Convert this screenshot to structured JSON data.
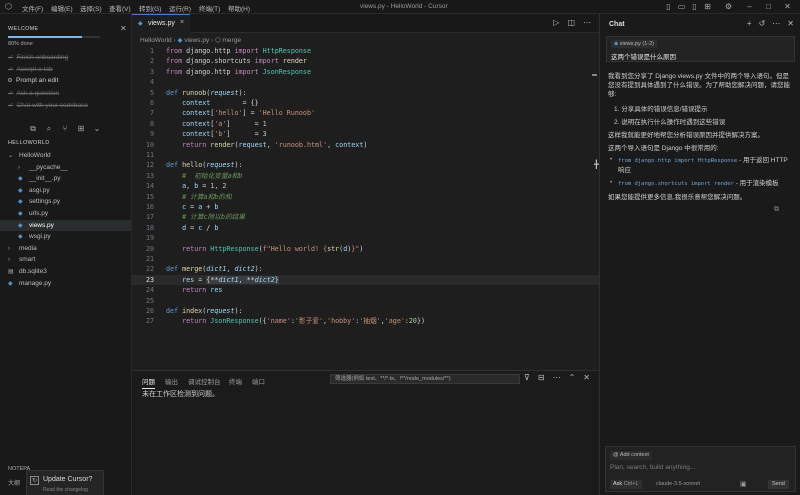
{
  "titlebar": {
    "menus": [
      "文件(F)",
      "编辑(E)",
      "选择(S)",
      "查看(V)",
      "转到(G)",
      "运行(R)",
      "终端(T)",
      "帮助(H)"
    ],
    "title": "views.py - HelloWorld - Cursor"
  },
  "sidebar": {
    "welcome": {
      "heading": "WELCOME",
      "progress_percent": 80,
      "progress_label": "80% done",
      "steps": [
        {
          "label": "Finish onboarding",
          "done": true
        },
        {
          "label": "Accept a tab",
          "done": true
        },
        {
          "label": "Prompt an edit",
          "done": false
        },
        {
          "label": "Ask a question",
          "done": true
        },
        {
          "label": "Chat with your codebase",
          "done": true
        }
      ]
    },
    "explorer": {
      "heading": "HELLOWORLD",
      "items": [
        {
          "label": "HelloWorld",
          "type": "folder-open",
          "depth": 0
        },
        {
          "label": "__pycache__",
          "type": "folder",
          "depth": 1
        },
        {
          "label": "__init__.py",
          "type": "py",
          "depth": 1
        },
        {
          "label": "asgi.py",
          "type": "py",
          "depth": 1
        },
        {
          "label": "settings.py",
          "type": "py",
          "depth": 1
        },
        {
          "label": "urls.py",
          "type": "py",
          "depth": 1
        },
        {
          "label": "views.py",
          "type": "py",
          "depth": 1,
          "selected": true
        },
        {
          "label": "wsgi.py",
          "type": "py",
          "depth": 1
        },
        {
          "label": "media",
          "type": "folder",
          "depth": 0
        },
        {
          "label": "smart",
          "type": "folder",
          "depth": 0
        },
        {
          "label": "db.sqlite3",
          "type": "db",
          "depth": 0
        },
        {
          "label": "manage.py",
          "type": "py",
          "depth": 0
        }
      ]
    },
    "notepad": "NOTEPA",
    "outline": "大纲",
    "update": {
      "title": "Update Cursor?",
      "subtitle": "Read the changelog"
    }
  },
  "editor": {
    "tab_label": "views.py",
    "breadcrumb": [
      "HelloWorld",
      "views.py",
      "merge"
    ],
    "current_line": 23,
    "lines": [
      {
        "n": 1,
        "tokens": [
          [
            "kw2",
            "from"
          ],
          [
            "t",
            " django.http "
          ],
          [
            "kw2",
            "import"
          ],
          [
            "cls",
            " HttpResponse"
          ]
        ]
      },
      {
        "n": 2,
        "tokens": [
          [
            "kw2",
            "from"
          ],
          [
            "t",
            " django.shortcuts "
          ],
          [
            "kw2",
            "import"
          ],
          [
            "fn",
            " render"
          ]
        ]
      },
      {
        "n": 3,
        "tokens": [
          [
            "kw2",
            "from"
          ],
          [
            "t",
            " django.http "
          ],
          [
            "kw2",
            "import"
          ],
          [
            "cls",
            " JsonResponse"
          ]
        ]
      },
      {
        "n": 4,
        "tokens": []
      },
      {
        "n": 5,
        "tokens": [
          [
            "kw",
            "def "
          ],
          [
            "fn",
            "runoob"
          ],
          [
            "t",
            "("
          ],
          [
            "param",
            "request"
          ],
          [
            "t",
            "):"
          ]
        ]
      },
      {
        "n": 6,
        "tokens": [
          [
            "t",
            "    "
          ],
          [
            "var",
            "context"
          ],
          [
            "t",
            "        = {}"
          ]
        ]
      },
      {
        "n": 7,
        "tokens": [
          [
            "t",
            "    "
          ],
          [
            "var",
            "context"
          ],
          [
            "t",
            "["
          ],
          [
            "str",
            "'hello'"
          ],
          [
            "t",
            "] = "
          ],
          [
            "str",
            "'Hello Runoob'"
          ]
        ]
      },
      {
        "n": 8,
        "tokens": [
          [
            "t",
            "    "
          ],
          [
            "var",
            "context"
          ],
          [
            "t",
            "["
          ],
          [
            "str",
            "'a'"
          ],
          [
            "t",
            "]      = "
          ],
          [
            "num",
            "1"
          ]
        ]
      },
      {
        "n": 9,
        "tokens": [
          [
            "t",
            "    "
          ],
          [
            "var",
            "context"
          ],
          [
            "t",
            "["
          ],
          [
            "str",
            "'b'"
          ],
          [
            "t",
            "]      = "
          ],
          [
            "num",
            "3"
          ]
        ]
      },
      {
        "n": 10,
        "tokens": [
          [
            "t",
            "    "
          ],
          [
            "kw2",
            "return "
          ],
          [
            "fn",
            "render"
          ],
          [
            "t",
            "("
          ],
          [
            "var",
            "request"
          ],
          [
            "t",
            ", "
          ],
          [
            "str",
            "'runoob.html'"
          ],
          [
            "t",
            ", "
          ],
          [
            "var",
            "context"
          ],
          [
            "t",
            ")"
          ]
        ]
      },
      {
        "n": 11,
        "tokens": []
      },
      {
        "n": 12,
        "tokens": [
          [
            "kw",
            "def "
          ],
          [
            "fn",
            "hello"
          ],
          [
            "t",
            "("
          ],
          [
            "param",
            "request"
          ],
          [
            "t",
            "):"
          ]
        ]
      },
      {
        "n": 13,
        "tokens": [
          [
            "t",
            "    "
          ],
          [
            "cm",
            "#  初始化变量a和b"
          ]
        ]
      },
      {
        "n": 14,
        "tokens": [
          [
            "t",
            "    "
          ],
          [
            "var",
            "a"
          ],
          [
            "t",
            ", "
          ],
          [
            "var",
            "b"
          ],
          [
            "t",
            " = "
          ],
          [
            "num",
            "1"
          ],
          [
            "t",
            ", "
          ],
          [
            "num",
            "2"
          ]
        ]
      },
      {
        "n": 15,
        "tokens": [
          [
            "t",
            "    "
          ],
          [
            "cm",
            "# 计算a和b的和"
          ]
        ]
      },
      {
        "n": 16,
        "tokens": [
          [
            "t",
            "    "
          ],
          [
            "var",
            "c"
          ],
          [
            "t",
            " = "
          ],
          [
            "var",
            "a"
          ],
          [
            "t",
            " + "
          ],
          [
            "var",
            "b"
          ]
        ]
      },
      {
        "n": 17,
        "tokens": [
          [
            "t",
            "    "
          ],
          [
            "cm",
            "# 计算c除以b的结果"
          ]
        ]
      },
      {
        "n": 18,
        "tokens": [
          [
            "t",
            "    "
          ],
          [
            "var",
            "d"
          ],
          [
            "t",
            " = "
          ],
          [
            "var",
            "c"
          ],
          [
            "t",
            " / "
          ],
          [
            "var",
            "b"
          ]
        ]
      },
      {
        "n": 19,
        "tokens": []
      },
      {
        "n": 20,
        "tokens": [
          [
            "t",
            "    "
          ],
          [
            "kw2",
            "return "
          ],
          [
            "cls",
            "HttpResponse"
          ],
          [
            "t",
            "("
          ],
          [
            "str",
            "f\"Hello world! {"
          ],
          [
            "fn",
            "str"
          ],
          [
            "t",
            "("
          ],
          [
            "var",
            "d"
          ],
          [
            "t",
            ")"
          ],
          [
            "str",
            "}\""
          ],
          [
            "t",
            ")"
          ]
        ]
      },
      {
        "n": 21,
        "tokens": []
      },
      {
        "n": 22,
        "tokens": [
          [
            "kw",
            "def "
          ],
          [
            "fn",
            "merge"
          ],
          [
            "t",
            "("
          ],
          [
            "param",
            "dict1"
          ],
          [
            "t",
            ", "
          ],
          [
            "param",
            "dict2"
          ],
          [
            "t",
            "):"
          ]
        ]
      },
      {
        "n": 23,
        "tokens": [
          [
            "t",
            "    "
          ],
          [
            "var",
            "res"
          ],
          [
            "t",
            " = "
          ],
          [
            "hl",
            "{**"
          ],
          [
            "hlp",
            "dict1"
          ],
          [
            "hl",
            ", **"
          ],
          [
            "hlp",
            "dict2"
          ],
          [
            "hl",
            "}"
          ]
        ]
      },
      {
        "n": 24,
        "tokens": [
          [
            "t",
            "    "
          ],
          [
            "kw2",
            "return "
          ],
          [
            "var",
            "res"
          ]
        ]
      },
      {
        "n": 25,
        "tokens": []
      },
      {
        "n": 26,
        "tokens": [
          [
            "kw",
            "def "
          ],
          [
            "fn",
            "index"
          ],
          [
            "t",
            "("
          ],
          [
            "param",
            "request"
          ],
          [
            "t",
            "):"
          ]
        ]
      },
      {
        "n": 27,
        "tokens": [
          [
            "t",
            "    "
          ],
          [
            "kw2",
            "return "
          ],
          [
            "cls",
            "JsonResponse"
          ],
          [
            "t",
            "({"
          ],
          [
            "str",
            "'name'"
          ],
          [
            "t",
            ":"
          ],
          [
            "str",
            "'影子爱'"
          ],
          [
            "t",
            ","
          ],
          [
            "str",
            "'hobby'"
          ],
          [
            "t",
            ":"
          ],
          [
            "str",
            "'抽烟'"
          ],
          [
            "t",
            ","
          ],
          [
            "str",
            "'age'"
          ],
          [
            "t",
            ":"
          ],
          [
            "num",
            "20"
          ],
          [
            "t",
            "})"
          ]
        ]
      }
    ]
  },
  "panel": {
    "tabs": [
      "问题",
      "输出",
      "调试控制台",
      "终端",
      "端口"
    ],
    "active_tab": 0,
    "filter_placeholder": "筛选器(例如 text、**/*.ts、!**/node_modules/**)",
    "message": "未在工作区检测到问题。"
  },
  "chat": {
    "title": "Chat",
    "user_chip": "views.py (1-2)",
    "user_message": "这两个错误是什么原因",
    "para1": "我看到您分享了 Django views.py 文件中的两个导入语句。但是您没有提到具体遇到了什么错误。为了帮助您解决问题，请您能够:",
    "list1": [
      "1. 分享具体的错误信息/错误提示",
      "2. 说明在执行什么操作时遇到这些错误"
    ],
    "para2": "这样我就能更好地帮您分析错误原因并提供解决方案。",
    "para3": "这两个导入语句是 Django 中很常用的:",
    "bullets": [
      {
        "code": "from django.http import HttpResponse",
        "text": " - 用于返回 HTTP 响应"
      },
      {
        "code": "from django.shortcuts import render",
        "text": " - 用于渲染模板"
      }
    ],
    "para4": "如果您能提供更多信息,我很乐意帮您解决问题。",
    "add_context": "Add context",
    "input_placeholder": "Plan, search, build anything...",
    "mode": "Ask",
    "mode_shortcut": "Ctrl+L",
    "model": "claude-3.5-sonnet",
    "send": "Send"
  }
}
